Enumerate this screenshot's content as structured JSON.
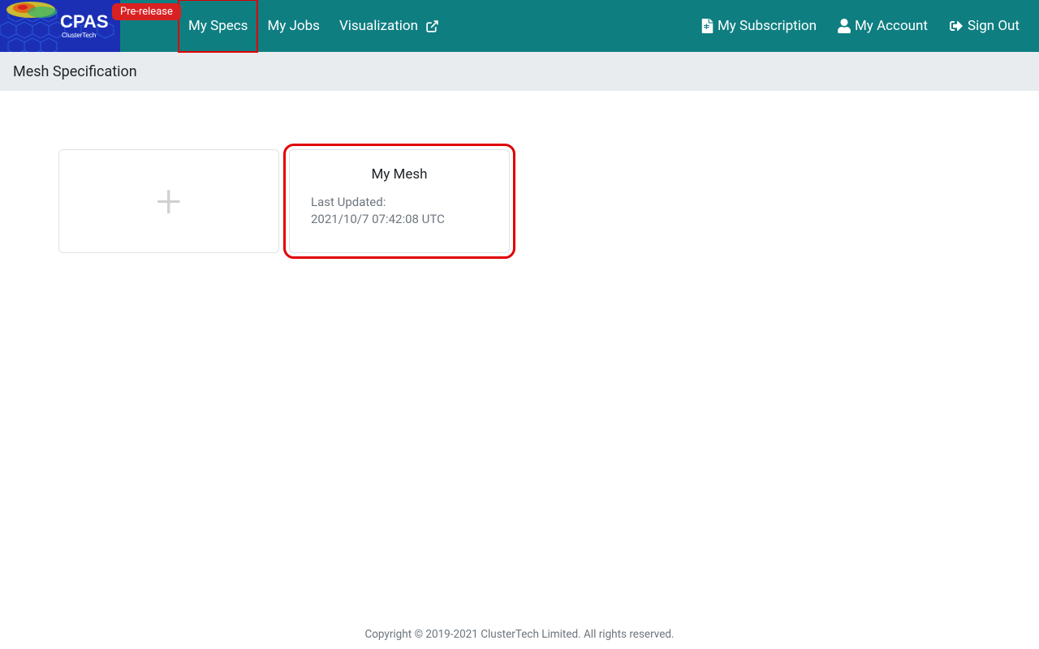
{
  "brand": {
    "name": "CPAS",
    "sub": "ClusterTech",
    "badge": "Pre-release"
  },
  "nav": {
    "specs": "My Specs",
    "jobs": "My Jobs",
    "viz": "Visualization",
    "subscription": "My Subscription",
    "account": "My Account",
    "signout": "Sign Out"
  },
  "page": {
    "title": "Mesh Specification"
  },
  "mesh": {
    "title": "My Mesh",
    "updated_label": "Last Updated:",
    "updated_value": "2021/10/7 07:42:08 UTC"
  },
  "footer": "Copyright © 2019-2021 ClusterTech Limited. All rights reserved."
}
